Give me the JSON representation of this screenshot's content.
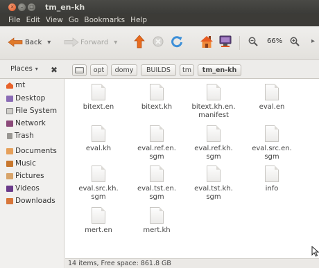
{
  "window": {
    "title": "tm_en-kh"
  },
  "menubar": [
    "File",
    "Edit",
    "View",
    "Go",
    "Bookmarks",
    "Help"
  ],
  "toolbar": {
    "back": "Back",
    "forward": "Forward",
    "zoom": "66%"
  },
  "pathbar": [
    "opt",
    "domy",
    "BUILDS",
    "tm",
    "tm_en-kh"
  ],
  "places": {
    "label": "Places",
    "items": [
      "mt",
      "Desktop",
      "File System",
      "Network",
      "Trash",
      "Documents",
      "Music",
      "Pictures",
      "Videos",
      "Downloads"
    ]
  },
  "files": [
    [
      "bitext.en"
    ],
    [
      "bitext.kh"
    ],
    [
      "bitext.kh.en.",
      "manifest"
    ],
    [
      "eval.en"
    ],
    [
      "eval.kh"
    ],
    [
      "eval.ref.en.",
      "sgm"
    ],
    [
      "eval.ref.kh.",
      "sgm"
    ],
    [
      "eval.src.en.",
      "sgm"
    ],
    [
      "eval.src.kh.",
      "sgm"
    ],
    [
      "eval.tst.en.",
      "sgm"
    ],
    [
      "eval.tst.kh.",
      "sgm"
    ],
    [
      "info"
    ],
    [
      "mert.en"
    ],
    [
      "mert.kh"
    ]
  ],
  "status": "14 items, Free space: 861.8 GB",
  "colors": {
    "titlebar": "#3c3b37",
    "close_button": "#e0521f",
    "text": "#333333"
  }
}
